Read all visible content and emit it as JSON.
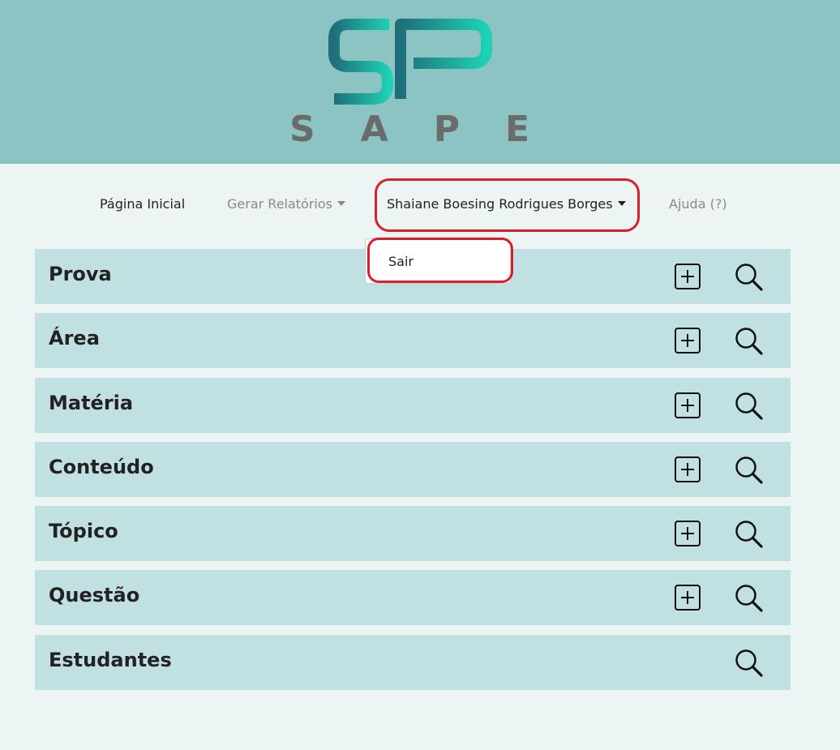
{
  "header": {
    "logo_letters": "SAPE",
    "logo_monogram": "SP"
  },
  "nav": {
    "home": "Página Inicial",
    "reports": "Gerar Relatórios",
    "user": "Shaiane Boesing Rodrigues Borges",
    "help": "Ajuda (?)"
  },
  "dropdown": {
    "logout": "Sair"
  },
  "sections": [
    {
      "title": "Prova",
      "has_add": true
    },
    {
      "title": "Área",
      "has_add": true
    },
    {
      "title": "Matéria",
      "has_add": true
    },
    {
      "title": "Conteúdo",
      "has_add": true
    },
    {
      "title": "Tópico",
      "has_add": true
    },
    {
      "title": "Questão",
      "has_add": true
    },
    {
      "title": "Estudantes",
      "has_add": false
    }
  ],
  "colors": {
    "header_bg": "#8cc3c3",
    "page_bg": "#ecf4f4",
    "row_bg": "#c1e0e1",
    "highlight": "#d8202b",
    "logo_gradient_start": "#1e6f7a",
    "logo_gradient_end": "#1ed2b4"
  },
  "icons": {
    "add": "plus-square-icon",
    "search": "search-icon",
    "caret": "caret-down-icon"
  }
}
